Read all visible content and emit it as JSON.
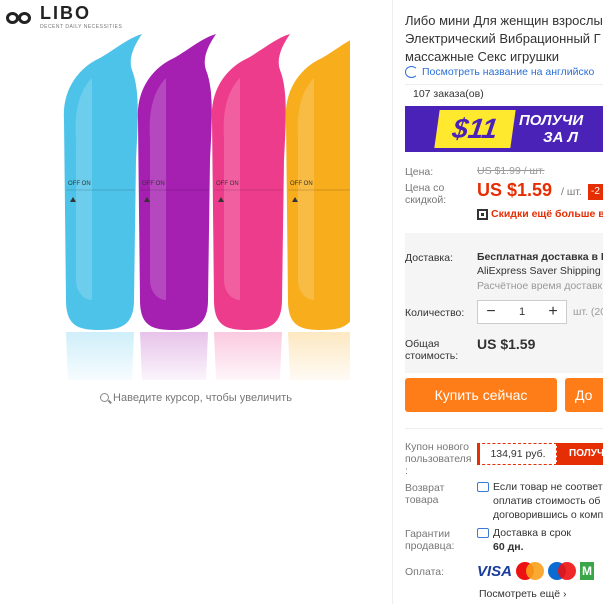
{
  "brand": {
    "name": "LIBO",
    "tagline": "DECENT DAILY NECESSITIES"
  },
  "gallery": {
    "zoom_hint": "Наведите курсор, чтобы увеличить",
    "switch_labels": [
      "OFF ON",
      "OFF ON",
      "OFF ON",
      "OFF ON"
    ],
    "colors": [
      "#4ec3ea",
      "#a51fb1",
      "#ee3c8c",
      "#f7ad1c"
    ]
  },
  "product": {
    "title_lines": [
      "Либо мини Для женщин взрослы",
      "Электрический Вибрационный Г",
      "массажные Секс игрушки"
    ],
    "translate_link": "Посмотреть название на английско",
    "orders": "107 заказа(ов)"
  },
  "promo": {
    "amount": "$11",
    "line1": "ПОЛУЧИ",
    "line2": "ЗА Л"
  },
  "price": {
    "label": "Цена:",
    "old": "US $1.99 / шт.",
    "discount_label_1": "Цена со",
    "discount_label_2": "скидкой:",
    "current": "US $1.59",
    "unit": "/ шт.",
    "badge": "-2",
    "more_discounts": "Скидки ещё больше в п"
  },
  "shipping": {
    "label": "Доставка:",
    "line1": "Бесплатная доставка в R",
    "line2": "AliExpress Saver Shipping",
    "time": "Расчётное время доставк"
  },
  "quantity": {
    "label": "Количество:",
    "value": "1",
    "minus": "−",
    "plus": "+",
    "unit": "шт. (20"
  },
  "total": {
    "label_1": "Общая",
    "label_2": "стоимость:",
    "value": "US $1.59"
  },
  "actions": {
    "buy_now": "Купить сейчас",
    "add_to_cart": "До"
  },
  "coupon": {
    "label_1": "Купон нового",
    "label_2": "пользователя",
    "label_3": ":",
    "amount": "134,91 руб.",
    "get": "ПОЛУЧ"
  },
  "returns": {
    "label_1": "Возврат",
    "label_2": "товара",
    "line1": "Если товар не соответ",
    "line2": "оплатив стоимость об",
    "line3": "договорившись о компе"
  },
  "guarantee": {
    "label_1": "Гарантии",
    "label_2": "продавца:",
    "line1": "Доставка в срок",
    "line2": "60 дн."
  },
  "payment": {
    "label": "Оплата:",
    "visa": "VISA",
    "mastercard": "mastercard",
    "maestro": "Maestro",
    "fourth": "M",
    "see_more": "Посмотреть ещё ›"
  }
}
